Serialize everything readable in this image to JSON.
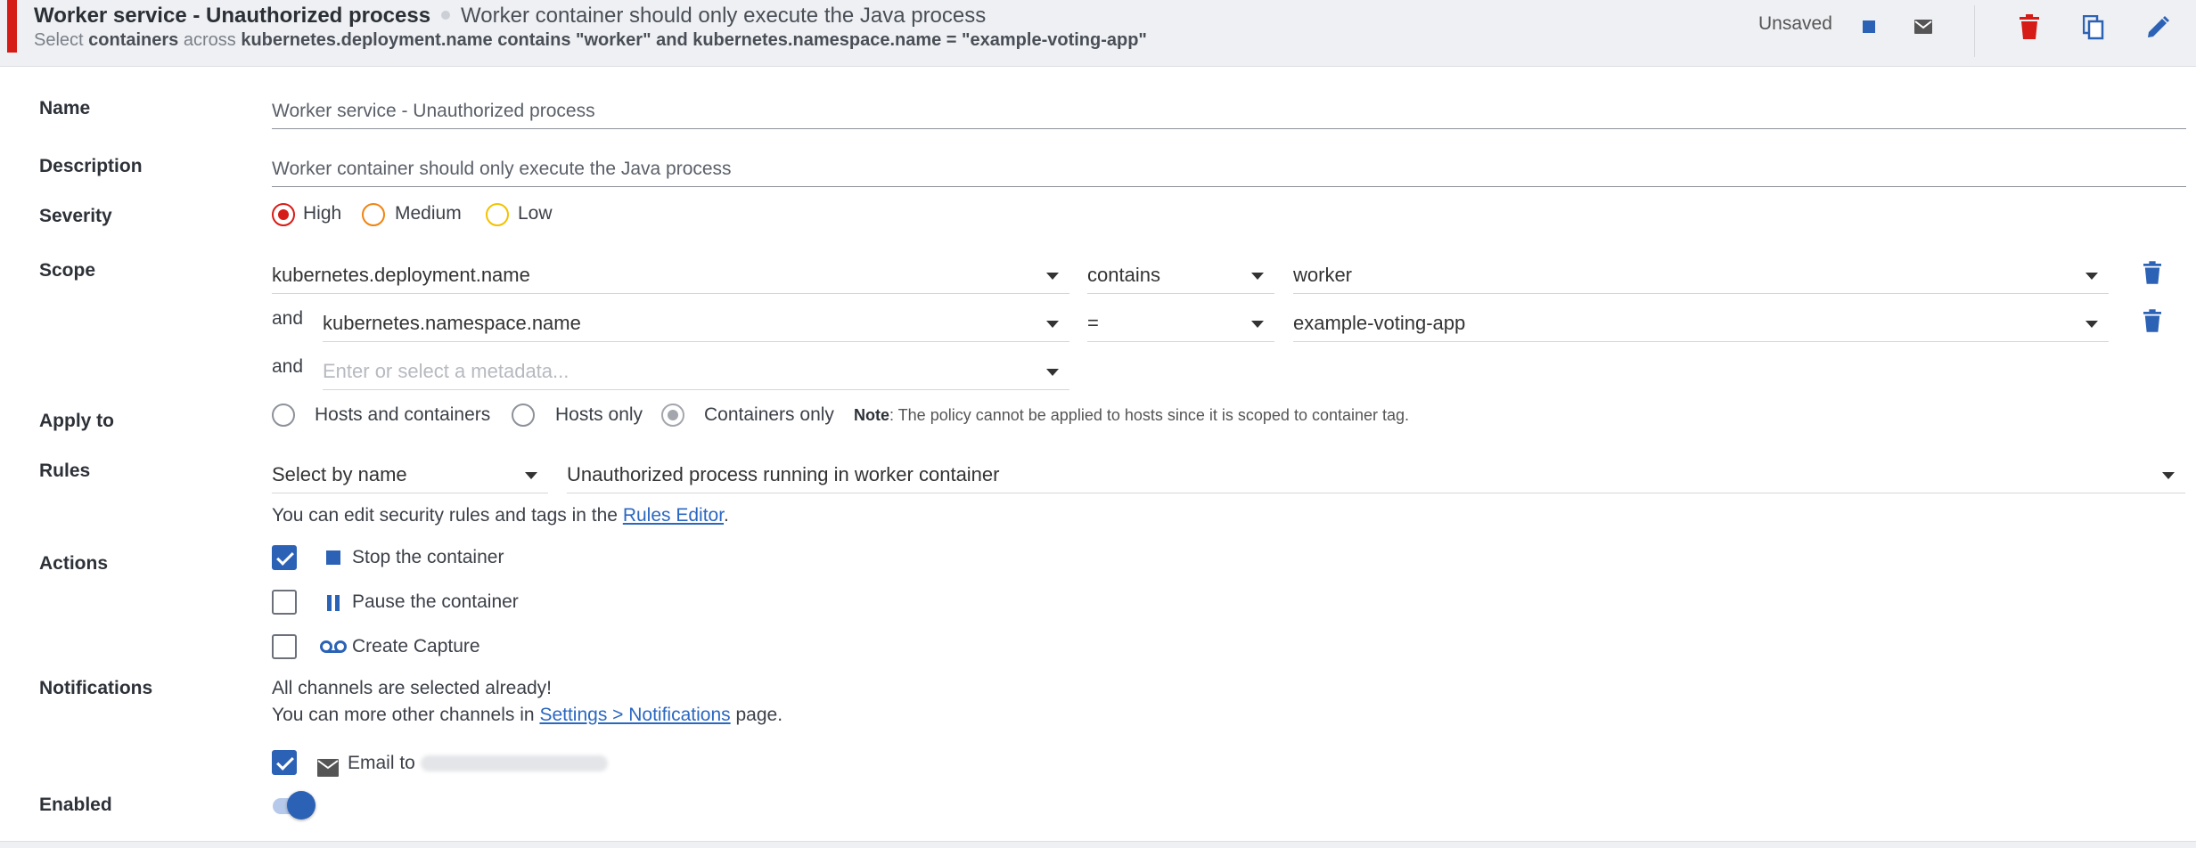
{
  "header": {
    "title": "Worker service - Unauthorized process",
    "description": "Worker container should only execute the Java process",
    "scope_prefix": "Select",
    "scope_target": "containers",
    "scope_across": "across",
    "scope_expression": "kubernetes.deployment.name contains \"worker\" and kubernetes.namespace.name = \"example-voting-app\"",
    "status": "Unsaved",
    "severity_color": "#d61c16"
  },
  "form": {
    "name": {
      "label": "Name",
      "value": "Worker service - Unauthorized process"
    },
    "description": {
      "label": "Description",
      "value": "Worker container should only execute the Java process"
    },
    "severity": {
      "label": "Severity",
      "options": [
        "High",
        "Medium",
        "Low"
      ],
      "selected": "High",
      "colors": {
        "High": "#d61c16",
        "Medium": "#f08410",
        "Low": "#f2c200"
      }
    },
    "scope": {
      "label": "Scope",
      "conjunction": "and",
      "rows": [
        {
          "key": "kubernetes.deployment.name",
          "operator": "contains",
          "value": "worker"
        },
        {
          "key": "kubernetes.namespace.name",
          "operator": "=",
          "value": "example-voting-app"
        }
      ],
      "new_placeholder": "Enter or select a metadata..."
    },
    "apply_to": {
      "label": "Apply to",
      "options": [
        "Hosts and containers",
        "Hosts only",
        "Containers only"
      ],
      "selected": "Containers only",
      "note_label": "Note",
      "note_text": ": The policy cannot be applied to hosts since it is scoped to container tag."
    },
    "rules": {
      "label": "Rules",
      "mode": "Select by name",
      "selected_rule": "Unauthorized process running in worker container",
      "help_prefix": "You can edit security rules and tags in the",
      "help_link": "Rules Editor",
      "help_suffix": "."
    },
    "actions": {
      "label": "Actions",
      "items": [
        {
          "label": "Stop the container",
          "checked": true,
          "icon": "stop-icon"
        },
        {
          "label": "Pause the container",
          "checked": false,
          "icon": "pause-icon"
        },
        {
          "label": "Create Capture",
          "checked": false,
          "icon": "capture-icon"
        }
      ]
    },
    "notifications": {
      "label": "Notifications",
      "line1": "All channels are selected already!",
      "line2_prefix": "You can more other channels in",
      "line2_link": "Settings > Notifications",
      "line2_suffix": "page.",
      "email_label": "Email to",
      "email_checked": true
    },
    "enabled": {
      "label": "Enabled",
      "value": true
    }
  },
  "colors": {
    "accent": "#2c62b5",
    "danger": "#d61c16"
  }
}
